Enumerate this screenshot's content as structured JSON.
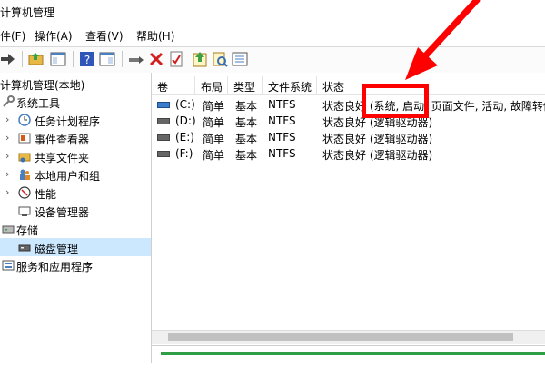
{
  "window": {
    "title": "计算机管理"
  },
  "menu": [
    {
      "label": "件(F)"
    },
    {
      "label": "操作(A)"
    },
    {
      "label": "查看(V)"
    },
    {
      "label": "帮助(H)"
    }
  ],
  "tree": {
    "root": "计算机管理(本地)",
    "items": [
      {
        "label": "系统工具"
      },
      {
        "label": "任务计划程序"
      },
      {
        "label": "事件查看器"
      },
      {
        "label": "共享文件夹"
      },
      {
        "label": "本地用户和组"
      },
      {
        "label": "性能"
      },
      {
        "label": "设备管理器"
      },
      {
        "label": "存储"
      },
      {
        "label": "磁盘管理"
      },
      {
        "label": "服务和应用程序"
      }
    ]
  },
  "columns": [
    {
      "label": "卷"
    },
    {
      "label": "布局"
    },
    {
      "label": "类型"
    },
    {
      "label": "文件系统"
    },
    {
      "label": "状态"
    }
  ],
  "volumes": [
    {
      "volume": "(C:)",
      "layout": "简单",
      "type": "基本",
      "fs": "NTFS",
      "status": "状态良好 (系统, 启动, 页面文件, 活动, 故障转储"
    },
    {
      "volume": "(D:)",
      "layout": "简单",
      "type": "基本",
      "fs": "NTFS",
      "status": "状态良好 (逻辑驱动器)"
    },
    {
      "volume": "(E:)",
      "layout": "简单",
      "type": "基本",
      "fs": "NTFS",
      "status": "状态良好 (逻辑驱动器)"
    },
    {
      "volume": "(F:)",
      "layout": "简单",
      "type": "基本",
      "fs": "NTFS",
      "status": "状态良好 (逻辑驱动器)"
    }
  ],
  "colors": {
    "annotation": "#ff0000",
    "selection": "#cce8ff",
    "disk_bar": "#2f9e44"
  }
}
